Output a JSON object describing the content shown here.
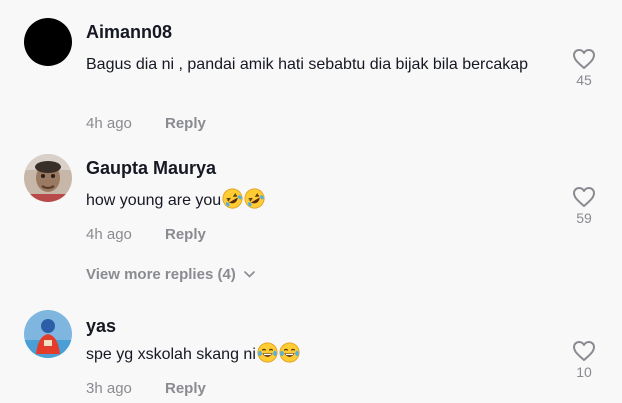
{
  "comments": [
    {
      "username": "Aimann08",
      "text": "Bagus dia ni , pandai amik hati sebabtu dia bijak bila bercakap",
      "time": "4h ago",
      "reply_label": "Reply",
      "likes": "45",
      "avatar": "black-circle-avatar"
    },
    {
      "username": "Gaupta Maurya",
      "text": "how young are you",
      "emojis": [
        "rolling-on-floor-laughing-emoji",
        "rolling-on-floor-laughing-emoji"
      ],
      "time": "4h ago",
      "reply_label": "Reply",
      "likes": "59",
      "avatar": "photo-avatar"
    },
    {
      "username": "yas",
      "text": "spe yg xskolah skang ni",
      "emojis": [
        "tears-of-joy-emoji",
        "tears-of-joy-emoji"
      ],
      "time": "3h ago",
      "reply_label": "Reply",
      "likes": "10",
      "avatar": "photo-avatar"
    }
  ],
  "view_more_replies": "View more replies (4)",
  "colors": {
    "background": "#f8f8f8",
    "text_primary": "#161823",
    "text_secondary": "#8a8b91"
  }
}
